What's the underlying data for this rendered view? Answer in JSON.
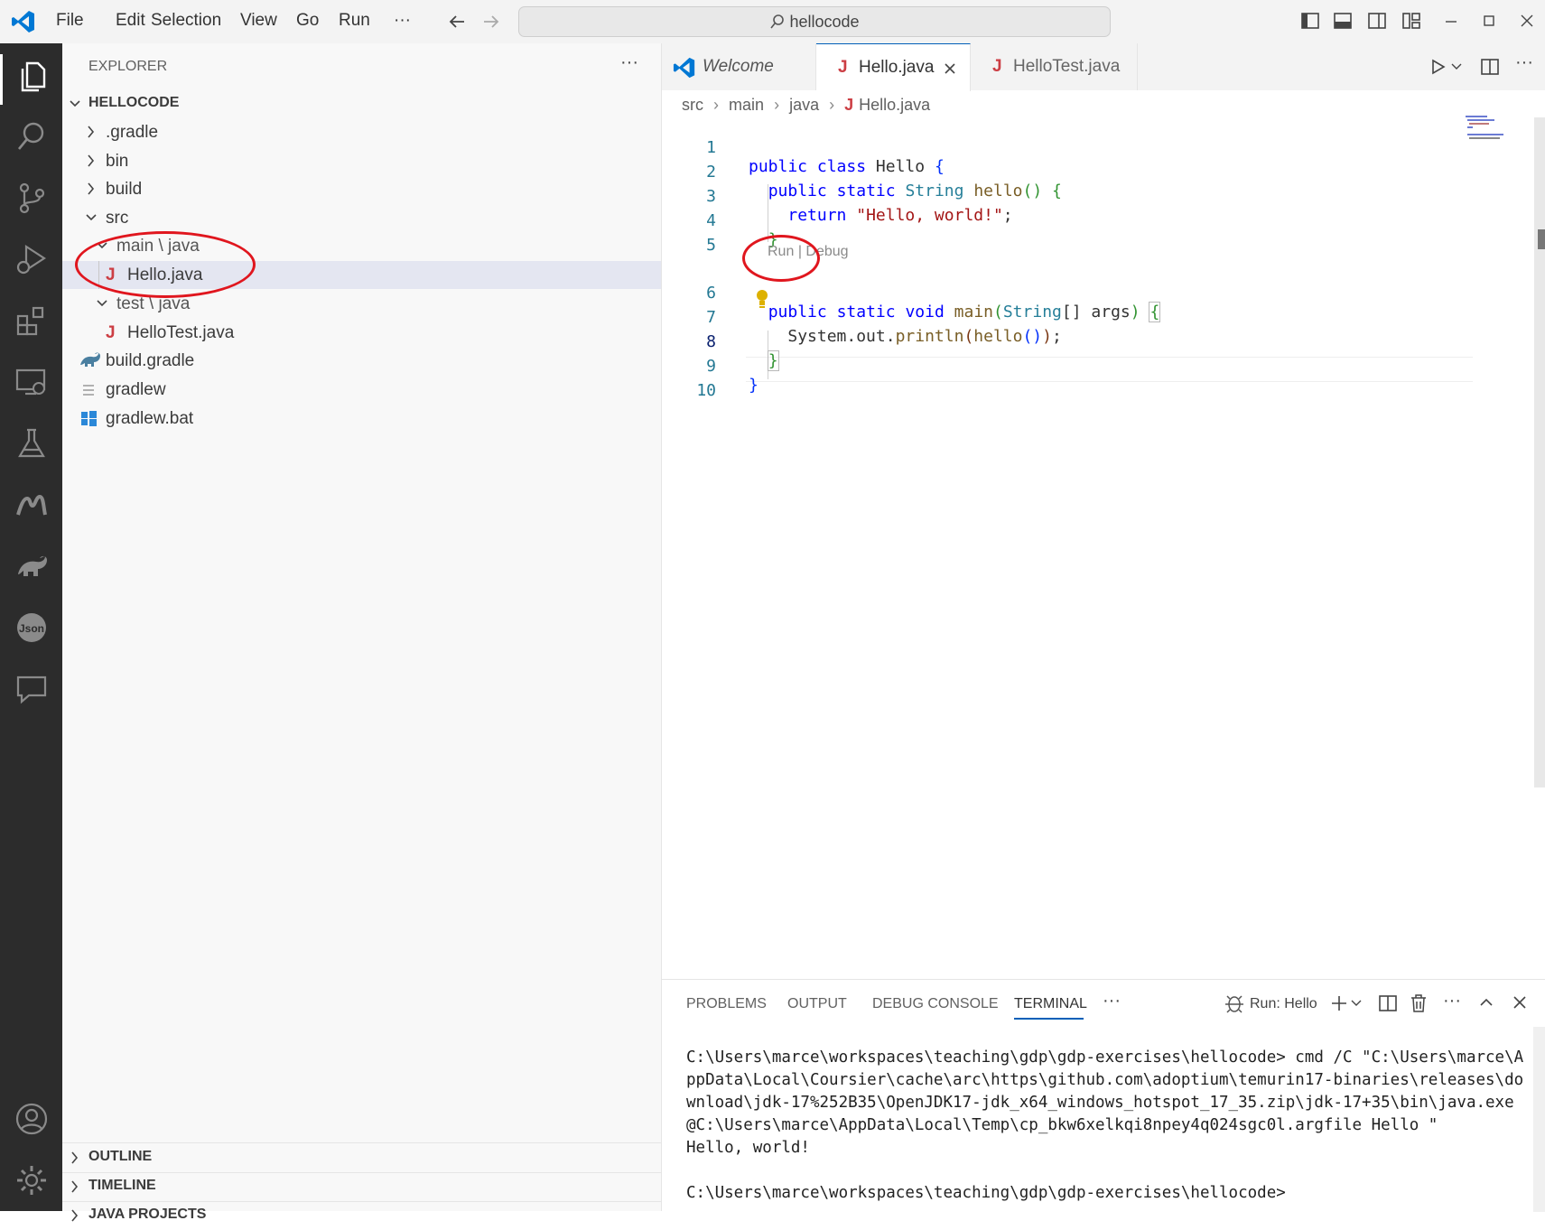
{
  "titlebar": {
    "menu": [
      "File",
      "Edit",
      "Selection",
      "View",
      "Go",
      "Run",
      "···"
    ],
    "search": "hellocode"
  },
  "activitybar": {
    "icons": [
      "explorer-icon",
      "search-icon",
      "source-control-icon",
      "run-debug-icon",
      "extensions-icon",
      "remote-explorer-icon",
      "testing-icon",
      "metals-icon",
      "gradle-icon",
      "json-icon",
      "chat-icon",
      "account-icon",
      "settings-icon"
    ]
  },
  "sidebar": {
    "title": "EXPLORER",
    "more": "···",
    "root": "HELLOCODE",
    "items": [
      {
        "label": ".gradle"
      },
      {
        "label": "bin"
      },
      {
        "label": "build"
      },
      {
        "label": "src"
      },
      {
        "label": "main \\ java"
      },
      {
        "label": "Hello.java"
      },
      {
        "label": "test \\ java"
      },
      {
        "label": "HelloTest.java"
      },
      {
        "label": "build.gradle"
      },
      {
        "label": "gradlew"
      },
      {
        "label": "gradlew.bat"
      }
    ],
    "outline": "OUTLINE",
    "timeline": "TIMELINE",
    "java_projects": "JAVA PROJECTS"
  },
  "editor": {
    "tabs": [
      {
        "label": "Welcome"
      },
      {
        "label": "Hello.java"
      },
      {
        "label": "HelloTest.java"
      }
    ],
    "breadcrumb": [
      "src",
      "main",
      "java",
      "Hello.java"
    ],
    "codelens": {
      "run": "Run",
      "sep": "|",
      "debug": "Debug"
    },
    "line_numbers": [
      "1",
      "2",
      "3",
      "4",
      "5",
      "6",
      "7",
      "8",
      "9",
      "10"
    ],
    "lines": {
      "l1": {
        "kw1": "public",
        "kw2": "class",
        "name": "Hello",
        "br": "{"
      },
      "l2": {
        "kw1": "public",
        "kw2": "static",
        "type": "String",
        "fn": "hello",
        "paren": "()",
        "br": "{"
      },
      "l3": {
        "kw": "return",
        "str": "\"Hello, world!\"",
        "semi": ";"
      },
      "l4": {
        "br": "}"
      },
      "l6": {
        "kw1": "public",
        "kw2": "static",
        "kw3": "void",
        "fn": "main",
        "p1": "(",
        "type": "String",
        "arr": "[]",
        "arg": "args",
        "p2": ")",
        "br": "{"
      },
      "l7": {
        "obj": "System.out.",
        "fn": "println",
        "p1": "(",
        "fn2": "hello",
        "inner": "()",
        "p2": ")",
        "semi": ";"
      },
      "l8": {
        "br": "}"
      },
      "l9": {
        "br": "}"
      }
    }
  },
  "panel": {
    "tabs": [
      "PROBLEMS",
      "OUTPUT",
      "DEBUG CONSOLE",
      "TERMINAL",
      "···"
    ],
    "run_label": "Run: Hello",
    "terminal": "C:\\Users\\marce\\workspaces\\teaching\\gdp\\gdp-exercises\\hellocode> cmd /C \"C:\\Users\\marce\\AppData\\Local\\Coursier\\cache\\arc\\https\\github.com\\adoptium\\temurin17-binaries\\releases\\download\\jdk-17%252B35\\OpenJDK17-jdk_x64_windows_hotspot_17_35.zip\\jdk-17+35\\bin\\java.exe @C:\\Users\\marce\\AppData\\Local\\Temp\\cp_bkw6xelkqi8npey4q024sgc0l.argfile Hello \"\nHello, world!\n\nC:\\Users\\marce\\workspaces\\teaching\\gdp\\gdp-exercises\\hellocode>"
  },
  "colors": {
    "accent": "#005fb8",
    "annotation": "#e0161e",
    "java_icon": "#cc3e44"
  }
}
